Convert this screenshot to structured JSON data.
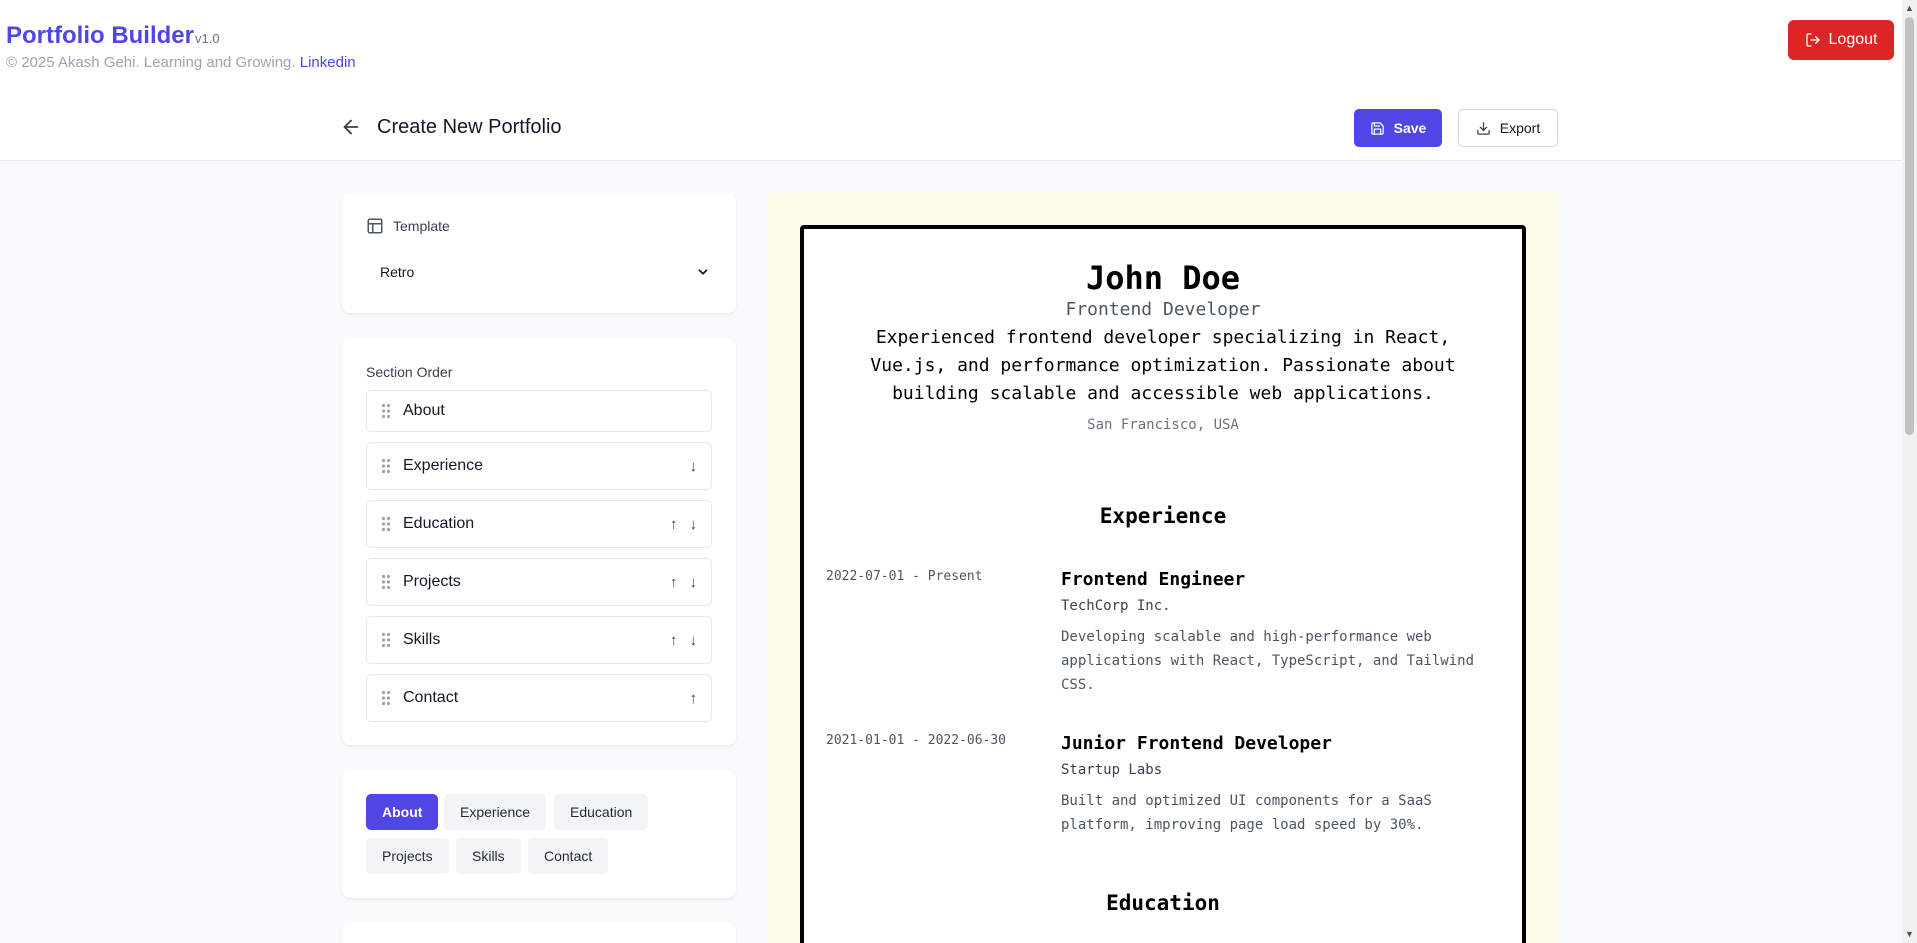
{
  "header": {
    "brand": "Portfolio Builder",
    "version": "v1.0",
    "copyright": "© 2025 Akash Gehi. Learning and Growing.",
    "linkedin": "Linkedin",
    "logout_label": "Logout",
    "logout_icon": "logout-icon"
  },
  "toolbar": {
    "back_icon": "arrow-left-icon",
    "title": "Create New Portfolio",
    "save_label": "Save",
    "export_label": "Export"
  },
  "template": {
    "label": "Template",
    "selected": "Retro"
  },
  "section_order": {
    "title": "Section Order",
    "items": [
      {
        "label": "About",
        "up": "",
        "down": ""
      },
      {
        "label": "Experience",
        "up": "",
        "down": "↓"
      },
      {
        "label": "Education",
        "up": "↑",
        "down": "↓"
      },
      {
        "label": "Projects",
        "up": "↑",
        "down": "↓"
      },
      {
        "label": "Skills",
        "up": "↑",
        "down": "↓"
      },
      {
        "label": "Contact",
        "up": "↑",
        "down": ""
      }
    ]
  },
  "tabs": [
    {
      "label": "About",
      "active": true
    },
    {
      "label": "Experience",
      "active": false
    },
    {
      "label": "Education",
      "active": false
    },
    {
      "label": "Projects",
      "active": false
    },
    {
      "label": "Skills",
      "active": false
    },
    {
      "label": "Contact",
      "active": false
    }
  ],
  "preview": {
    "name": "John Doe",
    "title": "Frontend Developer",
    "summary": "Experienced frontend developer specializing in React, Vue.js, and performance optimization. Passionate about building scalable and accessible web applications.",
    "location": "San Francisco, USA",
    "experience_heading": "Experience",
    "jobs": [
      {
        "dates": "2022-07-01 - Present",
        "title": "Frontend Engineer",
        "company": "TechCorp Inc.",
        "description": "Developing scalable and high-performance web applications with React, TypeScript, and Tailwind CSS."
      },
      {
        "dates": "2021-01-01 - 2022-06-30",
        "title": "Junior Frontend Developer",
        "company": "Startup Labs",
        "description": "Built and optimized UI components for a SaaS platform, improving page load speed by 30%."
      }
    ],
    "education_heading": "Education"
  },
  "colors": {
    "accent": "#4f46e5",
    "danger": "#dc2626",
    "preview_bg": "#fefce8"
  }
}
